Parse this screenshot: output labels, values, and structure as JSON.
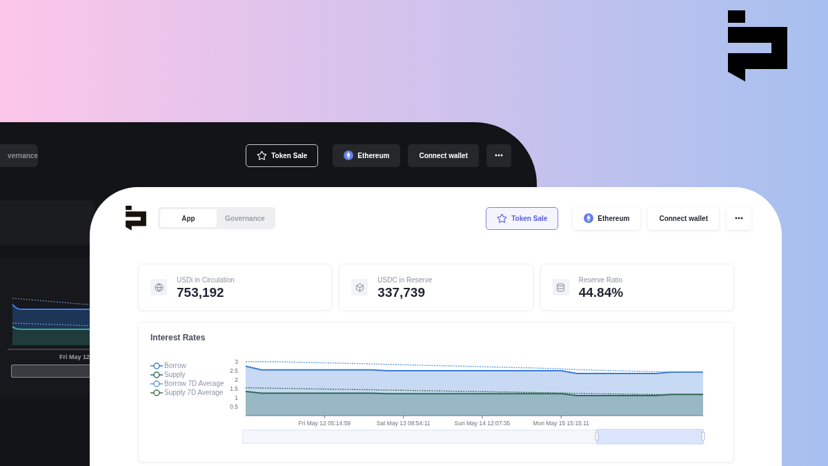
{
  "dark_window": {
    "tab_partial": "vernance",
    "actions": [
      {
        "kind": "outline",
        "label": "Token Sale"
      },
      {
        "kind": "network",
        "label": "Ethereum"
      },
      {
        "kind": "plain",
        "label": "Connect wallet"
      },
      {
        "kind": "more"
      }
    ],
    "axis_label": "Fri May 12"
  },
  "window": {
    "tabs": [
      {
        "label": "App",
        "selected": true
      },
      {
        "label": "Governance",
        "selected": false
      }
    ],
    "actions": [
      {
        "kind": "outline",
        "label": "Token Sale"
      },
      {
        "kind": "network",
        "label": "Ethereum"
      },
      {
        "kind": "plain",
        "label": "Connect wallet"
      },
      {
        "kind": "more"
      }
    ],
    "stats": [
      {
        "kind": "globe",
        "label": "USDi in Circulation",
        "value": "753,192"
      },
      {
        "kind": "box",
        "label": "USDC in Reserve",
        "value": "337,739"
      },
      {
        "kind": "database",
        "label": "Reserve Ratio",
        "value": "44.84%"
      }
    ],
    "interest_rates": {
      "title": "Interest Rates",
      "chart_data": {
        "type": "area",
        "categories": [
          null,
          null,
          null,
          null,
          null,
          "Fri May 12 05:14:59",
          null,
          null,
          null,
          null,
          "Sat May 13 08:54:11",
          null,
          null,
          null,
          null,
          "Sun May 14 12:07:35",
          null,
          null,
          null,
          null,
          "Mon May 15 15:15:11",
          null,
          null,
          null,
          null,
          null,
          null,
          null,
          null,
          null
        ],
        "series": [
          {
            "name": "Borrow",
            "color": "#3a7bd5",
            "type": "area",
            "line_style": "solid",
            "values": [
              2.75,
              2.55,
              2.55,
              2.55,
              2.55,
              2.55,
              2.55,
              2.55,
              2.55,
              2.5,
              2.5,
              2.5,
              2.5,
              2.5,
              2.5,
              2.5,
              2.5,
              2.5,
              2.5,
              2.5,
              2.5,
              2.35,
              2.35,
              2.35,
              2.35,
              2.35,
              2.35,
              2.42,
              2.42,
              2.42
            ]
          },
          {
            "name": "Supply",
            "color": "#2e6b5c",
            "type": "area",
            "line_style": "solid",
            "values": [
              1.35,
              1.25,
              1.25,
              1.25,
              1.25,
              1.25,
              1.25,
              1.25,
              1.25,
              1.22,
              1.22,
              1.22,
              1.22,
              1.22,
              1.22,
              1.22,
              1.22,
              1.22,
              1.22,
              1.22,
              1.22,
              1.12,
              1.12,
              1.12,
              1.12,
              1.12,
              1.12,
              1.18,
              1.18,
              1.18
            ]
          },
          {
            "name": "Borrow 7D Average",
            "color": "#5b9be6",
            "type": "line",
            "line_style": "dotted",
            "values": [
              3,
              3,
              3,
              2.98,
              2.96,
              2.94,
              2.92,
              2.9,
              2.88,
              2.85,
              2.83,
              2.81,
              2.79,
              2.77,
              2.75,
              2.72,
              2.7,
              2.68,
              2.66,
              2.63,
              2.6,
              2.56,
              2.53,
              2.51,
              2.49,
              2.47,
              2.45,
              2.44,
              2.43,
              2.42
            ]
          },
          {
            "name": "Supply 7D Average",
            "color": "#3f6e55",
            "type": "line",
            "line_style": "dotted",
            "values": [
              1.55,
              1.54,
              1.52,
              1.51,
              1.49,
              1.48,
              1.46,
              1.45,
              1.44,
              1.42,
              1.41,
              1.39,
              1.38,
              1.36,
              1.35,
              1.34,
              1.32,
              1.31,
              1.29,
              1.28,
              1.26,
              1.24,
              1.22,
              1.21,
              1.2,
              1.19,
              1.18,
              1.17,
              1.17,
              1.16
            ]
          }
        ],
        "ylim": [
          0,
          3
        ],
        "yticks": [
          {
            "value": 0.5,
            "label": "0.5"
          },
          {
            "value": 1,
            "label": "1"
          },
          {
            "value": 1.5,
            "label": "1.5"
          },
          {
            "value": 2,
            "label": "2"
          },
          {
            "value": 2.5,
            "label": "2.5"
          },
          {
            "value": 3,
            "label": "3"
          }
        ]
      }
    }
  }
}
